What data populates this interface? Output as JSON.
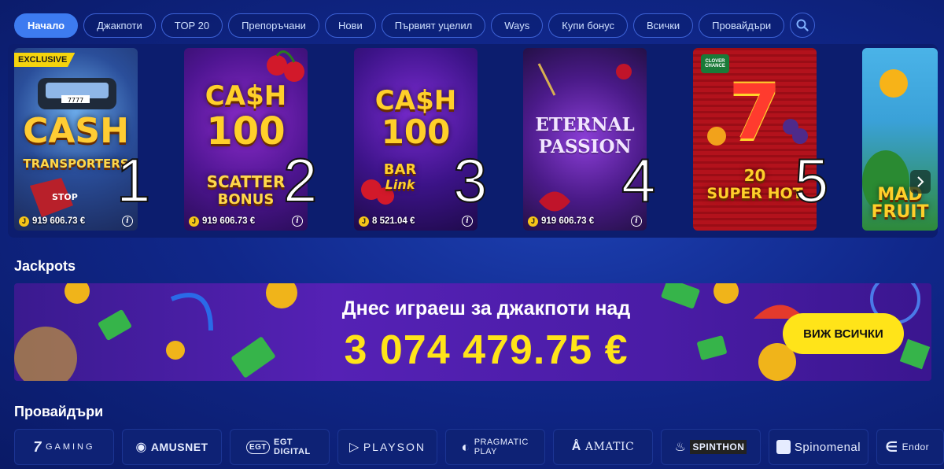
{
  "nav": {
    "items": [
      "Начало",
      "Джакпоти",
      "TOP 20",
      "Препоръчани",
      "Нови",
      "Първият уцелил",
      "Ways",
      "Купи бонус",
      "Всички",
      "Провайдъри"
    ],
    "active_index": 0
  },
  "games": [
    {
      "title": "CASH TRANSPORTERS",
      "rank": "1",
      "jackpot": "919 606.73 €",
      "badge": "EXCLUSIVE"
    },
    {
      "title": "CASH 100 SCATTER BONUS",
      "rank": "2",
      "jackpot": "919 606.73 €"
    },
    {
      "title": "CASH 100 BAR LINK",
      "rank": "3",
      "jackpot": "8 521.04 €"
    },
    {
      "title": "ETERNAL PASSION",
      "rank": "4",
      "jackpot": "919 606.73 €"
    },
    {
      "title": "20 SUPER HOT",
      "rank": "5",
      "jackpot": ""
    },
    {
      "title": "MAD FRUITS",
      "rank": "",
      "jackpot": ""
    }
  ],
  "game_art": {
    "g1_line1": "CASH",
    "g1_line2": "TRANSPORTERS",
    "g1_plate": "7777",
    "g1_sign": "STOP",
    "g2_line1": "CA$H",
    "g2_line2": "100",
    "g2_line3": "SCATTER",
    "g2_line4": "BONUS",
    "g3_line1": "CA$H",
    "g3_line2": "100",
    "g3_line3": "BAR",
    "g3_line4": "Link",
    "g4_line1": "ETERNAL",
    "g4_line2": "PASSION",
    "g5_line1": "7",
    "g5_line2": "20",
    "g5_line3": "SUPER HOT",
    "g5_logo": "CLOVER CHANCE",
    "g6_line1": "MAD",
    "g6_line2": "FRUIT"
  },
  "jackpots": {
    "title": "Jackpots",
    "banner_text": "Днес играеш за джакпоти над",
    "amount": "3 074 479.75 €",
    "button": "ВИЖ ВСИЧКИ"
  },
  "providers": {
    "title": "Провайдъри",
    "items": [
      "GAMING",
      "AMUSNET",
      "EGT DIGITAL",
      "PLAYSON",
      "PRAGMATIC PLAY",
      "AMATIC",
      "SPINTHON",
      "Spinomenal",
      "Endor"
    ]
  },
  "colors": {
    "accent": "#3d7bf0",
    "jackpot_yellow": "#ffe419",
    "background": "#10278a"
  }
}
